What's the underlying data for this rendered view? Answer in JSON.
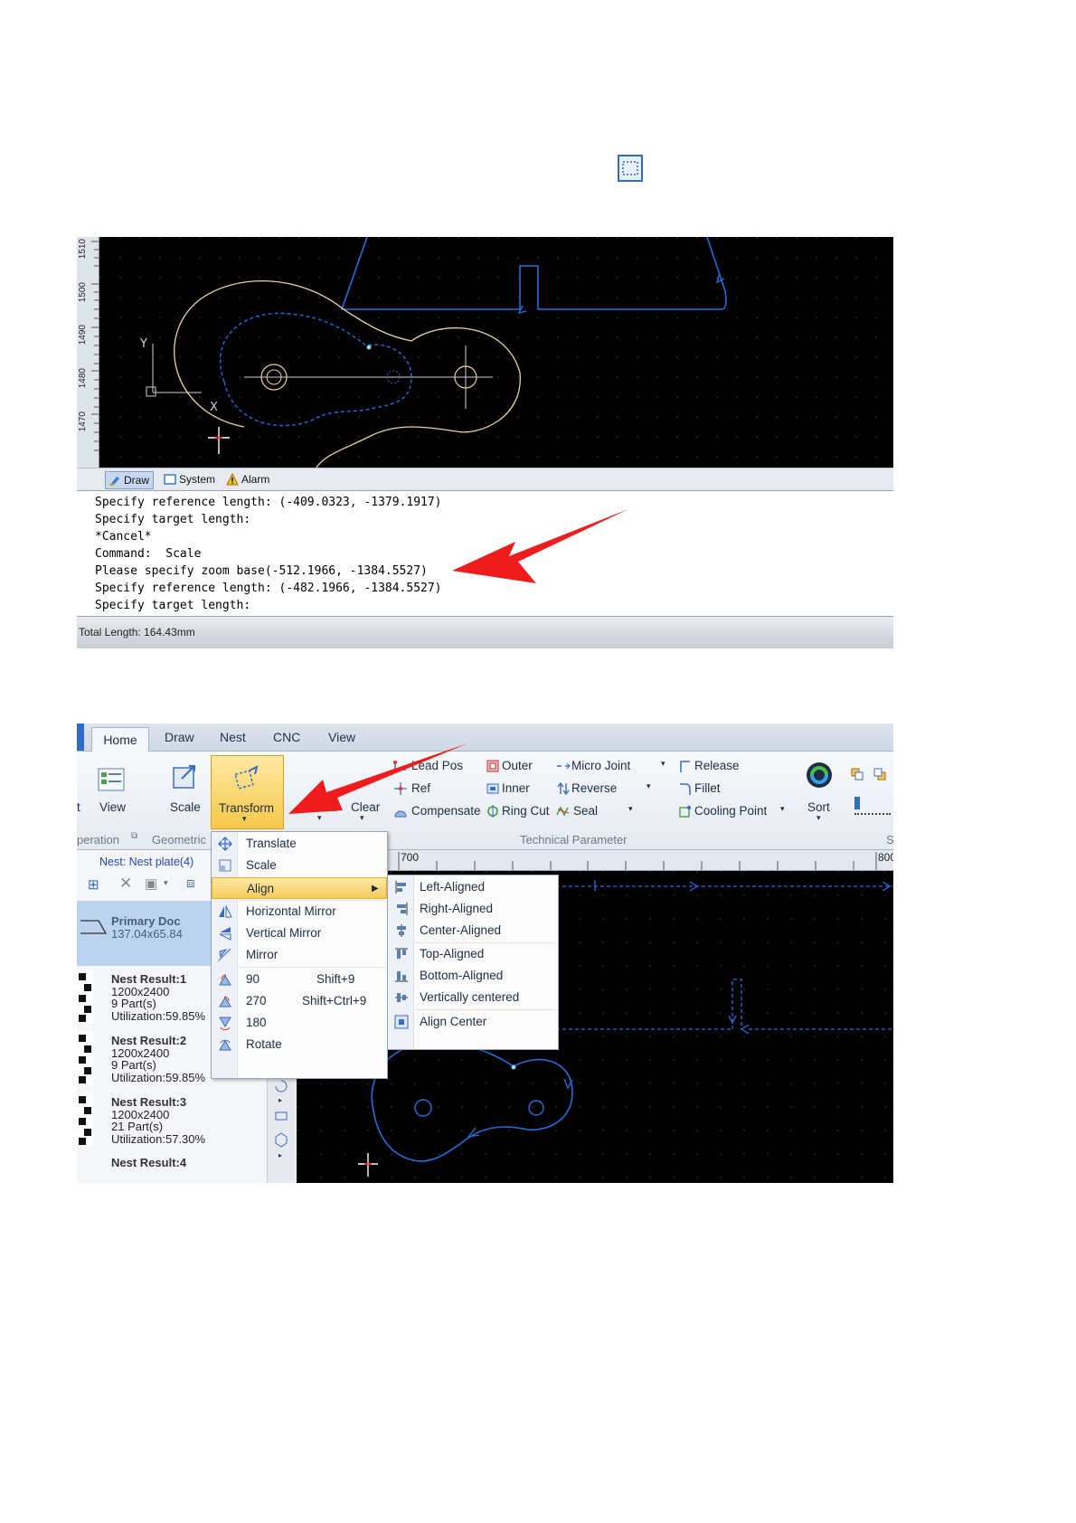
{
  "inline_icon": "select-window-icon",
  "screenshot1": {
    "ruler_labels": [
      "1510",
      "1500",
      "1490",
      "1480",
      "1470"
    ],
    "canvas_axis_labels": {
      "y": "Y",
      "x": "X"
    },
    "tabs": [
      {
        "label": "Draw",
        "icon": "draw-icon"
      },
      {
        "label": "System",
        "icon": "system-icon"
      },
      {
        "label": "Alarm",
        "icon": "alarm-warning-icon"
      }
    ],
    "command_lines": [
      "Specify reference length: (-409.0323, -1379.1917)",
      "Specify target length:",
      "*Cancel*",
      "Command:  Scale",
      "Please specify zoom base(-512.1966, -1384.5527)",
      "Specify reference length: (-482.1966, -1384.5527)",
      "Specify target length:"
    ],
    "status": "Total Length: 164.43mm",
    "colors": {
      "canvas": "#000000",
      "part_outline": "#e8d3a0",
      "toolpath": "#2a6bd8",
      "arrow": "#ee1c1c"
    }
  },
  "screenshot2": {
    "ribbon_tabs": [
      "Home",
      "Draw",
      "Nest",
      "CNC",
      "View"
    ],
    "ribbon_buttons": {
      "t": "t",
      "view": "View",
      "scale": "Scale",
      "transform": "Transform",
      "lead": "Lead",
      "clear": "Clear",
      "sort": "Sort"
    },
    "group_labels": {
      "operation": "peration",
      "geometric": "Geometric",
      "technical": "Technical Parameter",
      "s": "S"
    },
    "technical_items": {
      "lead_pos": "Lead Pos",
      "ref": "Ref",
      "compensate": "Compensate",
      "outer": "Outer",
      "inner": "Inner",
      "ring_cut": "Ring Cut",
      "micro_joint": "Micro Joint",
      "reverse": "Reverse",
      "seal": "Seal",
      "release": "Release",
      "fillet": "Fillet",
      "cooling_point": "Cooling Point"
    },
    "nest_label": "Nest: Nest plate(4)",
    "primary_doc": {
      "title": "Primary Doc",
      "size": "137.04x65.84"
    },
    "nest_results": [
      {
        "title": "Nest Result:1",
        "sheet": "1200x2400",
        "parts": "9 Part(s)",
        "util": "Utilization:59.85%"
      },
      {
        "title": "Nest Result:2",
        "sheet": "1200x2400",
        "parts": "9 Part(s)",
        "util": "Utilization:59.85%"
      },
      {
        "title": "Nest Result:3",
        "sheet": "1200x2400",
        "parts": "21 Part(s)",
        "util": "Utilization:57.30%"
      },
      {
        "title": "Nest Result:4"
      }
    ],
    "ruler_labels": [
      "700",
      "800"
    ],
    "transform_menu": [
      {
        "label": "Translate",
        "icon": "translate-icon"
      },
      {
        "label": "Scale",
        "icon": "scale-icon"
      },
      {
        "label": "Align",
        "icon": "",
        "submenu": true
      },
      {
        "label": "Horizontal Mirror",
        "icon": "horizontal-mirror-icon"
      },
      {
        "label": "Vertical Mirror",
        "icon": "vertical-mirror-icon"
      },
      {
        "label": "Mirror",
        "icon": "mirror-icon"
      },
      {
        "label": "90",
        "shortcut": "Shift+9",
        "icon": "rotate-90-icon"
      },
      {
        "label": "270",
        "shortcut": "Shift+Ctrl+9",
        "icon": "rotate-270-icon"
      },
      {
        "label": "180",
        "icon": "rotate-180-icon"
      },
      {
        "label": "Rotate",
        "icon": "rotate-icon"
      }
    ],
    "align_menu": [
      {
        "label": "Left-Aligned",
        "icon": "align-left-icon"
      },
      {
        "label": "Right-Aligned",
        "icon": "align-right-icon"
      },
      {
        "label": "Center-Aligned",
        "icon": "align-center-icon"
      },
      {
        "label": "Top-Aligned",
        "icon": "align-top-icon"
      },
      {
        "label": "Bottom-Aligned",
        "icon": "align-bottom-icon"
      },
      {
        "label": "Vertically centered",
        "icon": "align-vcenter-icon"
      },
      {
        "label": "Align Center",
        "icon": "align-center-both-icon"
      }
    ],
    "colors": {
      "highlight": "#f8cd5a",
      "nest_link": "#2248b8",
      "canvas": "#000000",
      "toolpath": "#2a6bd8"
    }
  }
}
